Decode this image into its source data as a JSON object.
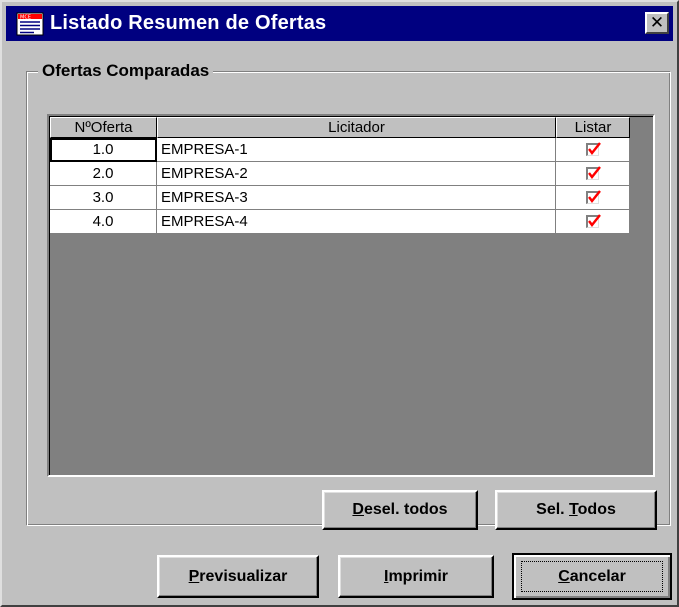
{
  "window": {
    "title": "Listado Resumen de Ofertas",
    "close_label": "✕"
  },
  "group": {
    "label": "Ofertas Comparadas"
  },
  "table": {
    "columns": [
      "NºOferta",
      "Licitador",
      "Listar"
    ],
    "rows": [
      {
        "num": "1.0",
        "licitador": "EMPRESA-1",
        "listar": true
      },
      {
        "num": "2.0",
        "licitador": "EMPRESA-2",
        "listar": true
      },
      {
        "num": "3.0",
        "licitador": "EMPRESA-3",
        "listar": true
      },
      {
        "num": "4.0",
        "licitador": "EMPRESA-4",
        "listar": true
      }
    ]
  },
  "buttons": {
    "deselect_all": {
      "mnemonic": "D",
      "rest": "esel. todos"
    },
    "select_all": {
      "prefix": "Sel. ",
      "mnemonic": "T",
      "rest": "odos"
    },
    "preview": {
      "mnemonic": "P",
      "rest": "revisualizar"
    },
    "print": {
      "mnemonic": "I",
      "rest": "mprimir"
    },
    "cancel": {
      "mnemonic": "C",
      "rest": "ancelar"
    }
  },
  "colors": {
    "titlebar": "#000080",
    "face": "#c0c0c0",
    "check": "#ff0000"
  }
}
